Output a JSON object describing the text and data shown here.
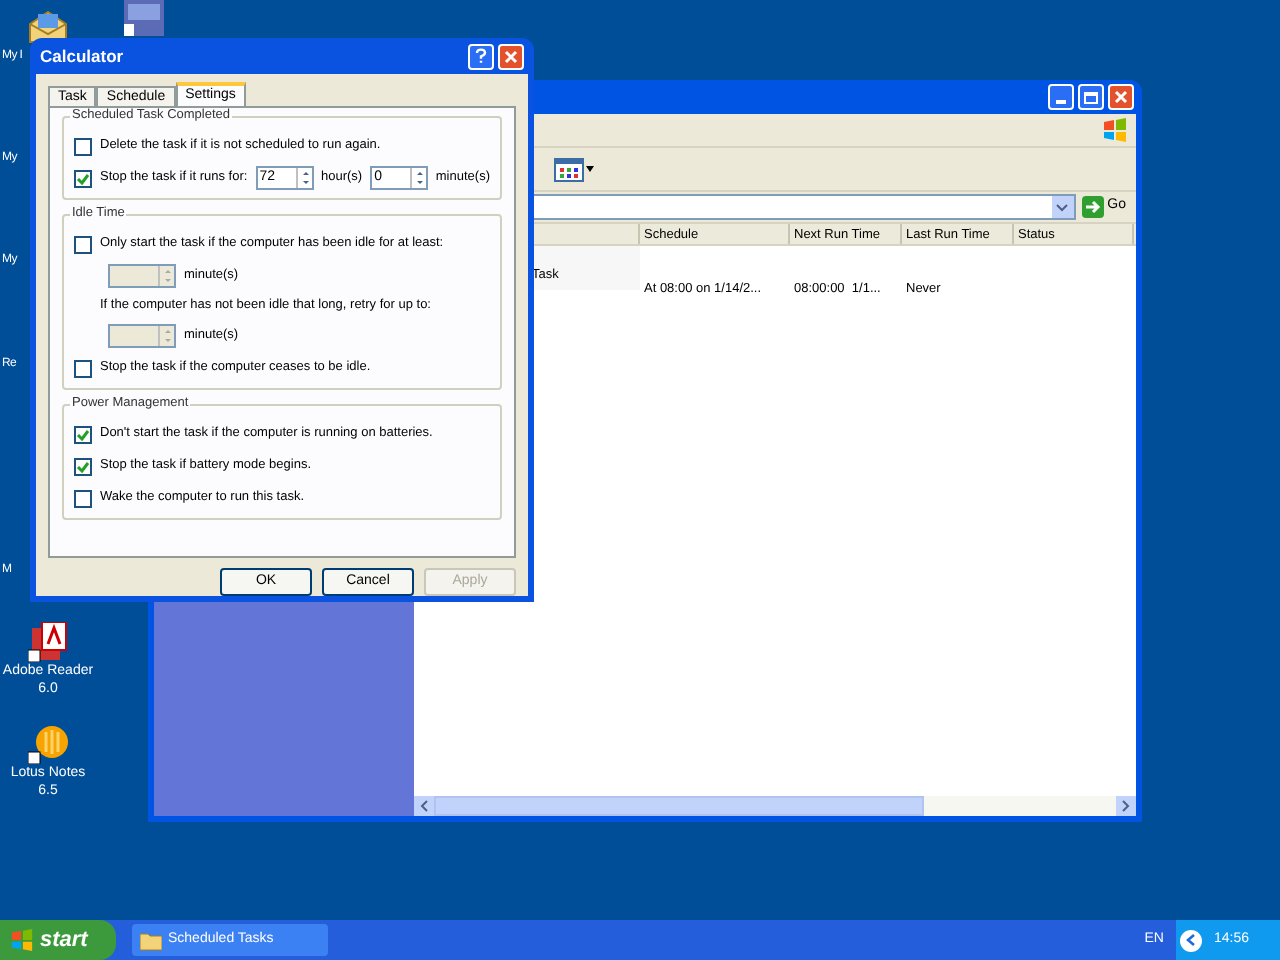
{
  "desktop_icons": [
    {
      "label": "My I",
      "kind": "cut"
    },
    {
      "label": "My",
      "kind": "cut"
    },
    {
      "label": "My",
      "kind": "cut"
    },
    {
      "label": "Re",
      "kind": "cut"
    },
    {
      "label": "M",
      "kind": "cut"
    },
    {
      "label": "Adobe Reader 6.0",
      "kind": "reader"
    },
    {
      "label": "Lotus Notes 6.5",
      "kind": "notes"
    }
  ],
  "explorer": {
    "go_label": "Go",
    "columns": [
      "Schedule",
      "Next Run Time",
      "Last Run Time",
      "Status"
    ],
    "rows": [
      {
        "name": "Task",
        "schedule": "At 08:00 on 1/14/2...",
        "next_run": "08:00:00  1/1...",
        "last_run": "Never"
      }
    ]
  },
  "dialog": {
    "title": "Calculator",
    "tabs": [
      {
        "label": "Task",
        "selected": false
      },
      {
        "label": "Schedule",
        "selected": false
      },
      {
        "label": "Settings",
        "selected": true
      }
    ],
    "groups": [
      {
        "title": "Scheduled Task Completed",
        "rows": [
          {
            "kind": "checkbox",
            "label": "Delete the task if it is not scheduled to run again.",
            "checked": false
          },
          {
            "kind": "duration",
            "label": "Stop the task if it runs for:",
            "checked": true,
            "hours": "72",
            "hours_unit": "hour(s)",
            "minutes": "0",
            "minutes_unit": "minute(s)"
          }
        ]
      },
      {
        "title": "Idle Time",
        "rows": [
          {
            "kind": "checkbox",
            "label": "Only start the task if the computer has been idle for at least:",
            "checked": false
          },
          {
            "kind": "spinner",
            "unit": "minute(s)",
            "disabled": true
          },
          {
            "kind": "text",
            "label": "If the computer has not been idle that long, retry for up to:"
          },
          {
            "kind": "spinner",
            "unit": "minute(s)",
            "disabled": true
          },
          {
            "kind": "checkbox",
            "label": "Stop the task if the computer ceases to be idle.",
            "checked": false
          }
        ]
      },
      {
        "title": "Power Management",
        "rows": [
          {
            "kind": "checkbox",
            "label": "Don't start the task if the computer is running on batteries.",
            "checked": true
          },
          {
            "kind": "checkbox",
            "label": "Stop the task if battery mode begins.",
            "checked": true
          },
          {
            "kind": "checkbox",
            "label": "Wake the computer to run this task.",
            "checked": false
          }
        ]
      }
    ],
    "buttons": [
      {
        "label": "OK",
        "disabled": false
      },
      {
        "label": "Cancel",
        "disabled": false
      },
      {
        "label": "Apply",
        "disabled": true
      }
    ]
  },
  "taskbar": {
    "start_label": "start",
    "tasks": [
      {
        "label": "Scheduled Tasks"
      }
    ],
    "language": "EN",
    "clock": "14:56"
  }
}
